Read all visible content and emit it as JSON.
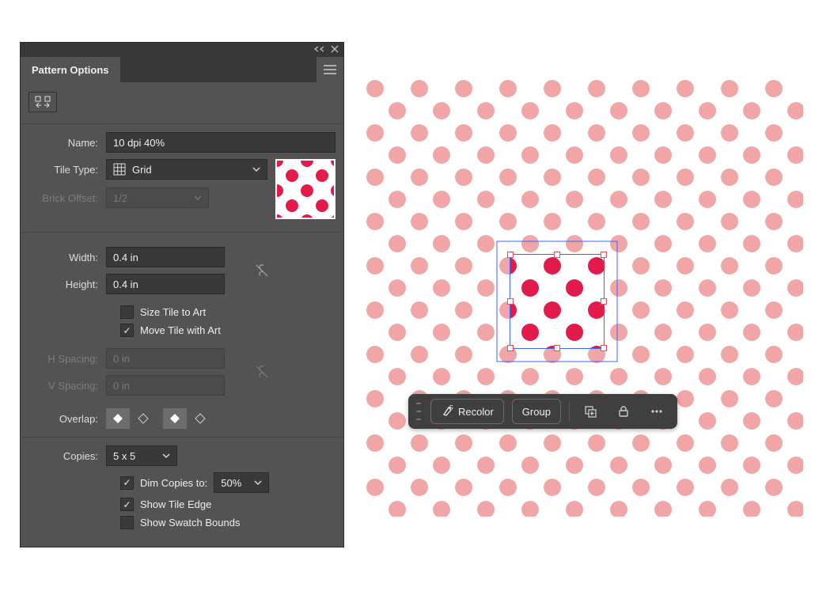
{
  "panel": {
    "title": "Pattern Options",
    "name": {
      "label": "Name:",
      "value": "10 dpi 40%"
    },
    "tile_type": {
      "label": "Tile Type:",
      "value": "Grid"
    },
    "brick_offset": {
      "label": "Brick Offset:",
      "value": "1/2"
    },
    "width": {
      "label": "Width:",
      "value": "0.4 in"
    },
    "height": {
      "label": "Height:",
      "value": "0.4 in"
    },
    "size_tile_to_art": {
      "label": "Size Tile to Art",
      "checked": false
    },
    "move_tile_with_art": {
      "label": "Move Tile with Art",
      "checked": true
    },
    "h_spacing": {
      "label": "H Spacing:",
      "value": "0 in"
    },
    "v_spacing": {
      "label": "V Spacing:",
      "value": "0 in"
    },
    "overlap": {
      "label": "Overlap:"
    },
    "copies": {
      "label": "Copies:",
      "value": "5 x 5"
    },
    "dim_copies": {
      "label": "Dim Copies to:",
      "value": "50%",
      "checked": true
    },
    "show_tile_edge": {
      "label": "Show Tile Edge",
      "checked": true
    },
    "show_swatch_bounds": {
      "label": "Show Swatch Bounds",
      "checked": false
    }
  },
  "contextbar": {
    "recolor": "Recolor",
    "group": "Group"
  },
  "colors": {
    "dot_dim": "#f0a6a6",
    "dot_full": "#e31b4b",
    "selection": "#3a67ff"
  }
}
